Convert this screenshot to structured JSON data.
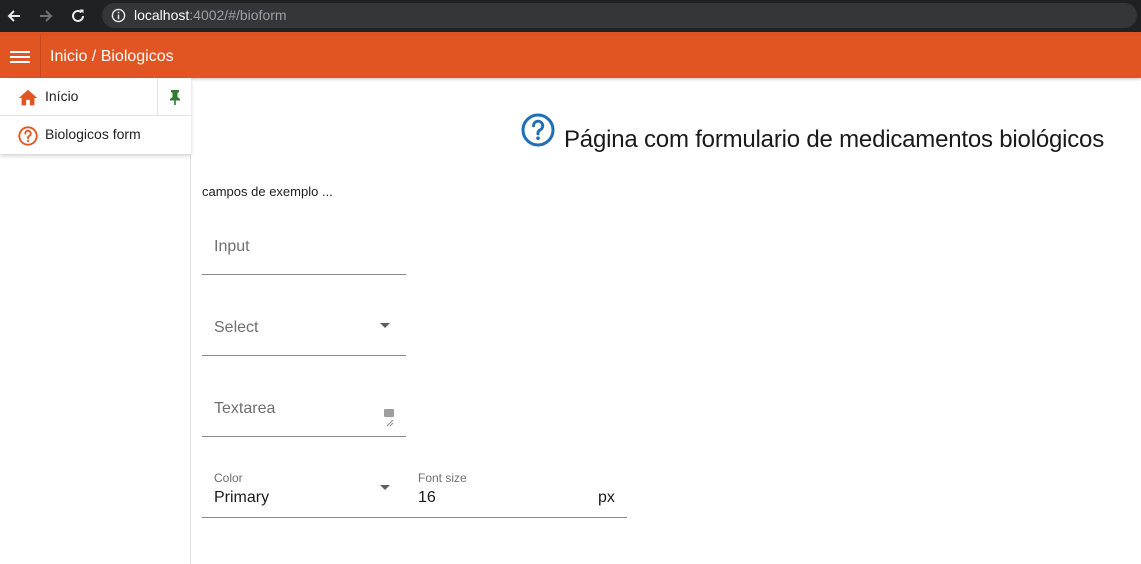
{
  "browser": {
    "url_host": "localhost",
    "url_rest": ":4002/#/bioform"
  },
  "header": {
    "title": "Inicio / Biologicos"
  },
  "sidebar": {
    "items": [
      {
        "label": "Início",
        "icon": "home-icon"
      },
      {
        "label": "Biologicos form",
        "icon": "help-circle-icon"
      }
    ],
    "pin_icon": "pin-icon"
  },
  "main": {
    "heading": "Página com formulario de medicamentos biológicos",
    "heading_icon": "help-circle-icon",
    "subtitle": "campos de exemplo ...",
    "fields": {
      "input_label": "Input",
      "select_label": "Select",
      "textarea_label": "Textarea",
      "color_label": "Color",
      "color_value": "Primary",
      "font_size_label": "Font size",
      "font_size_value": "16",
      "font_size_suffix": "px"
    }
  },
  "colors": {
    "accent": "#e05521",
    "heading_icon": "#1e6fb5",
    "pin": "#2e7d32",
    "browser_dark": "#202124"
  }
}
